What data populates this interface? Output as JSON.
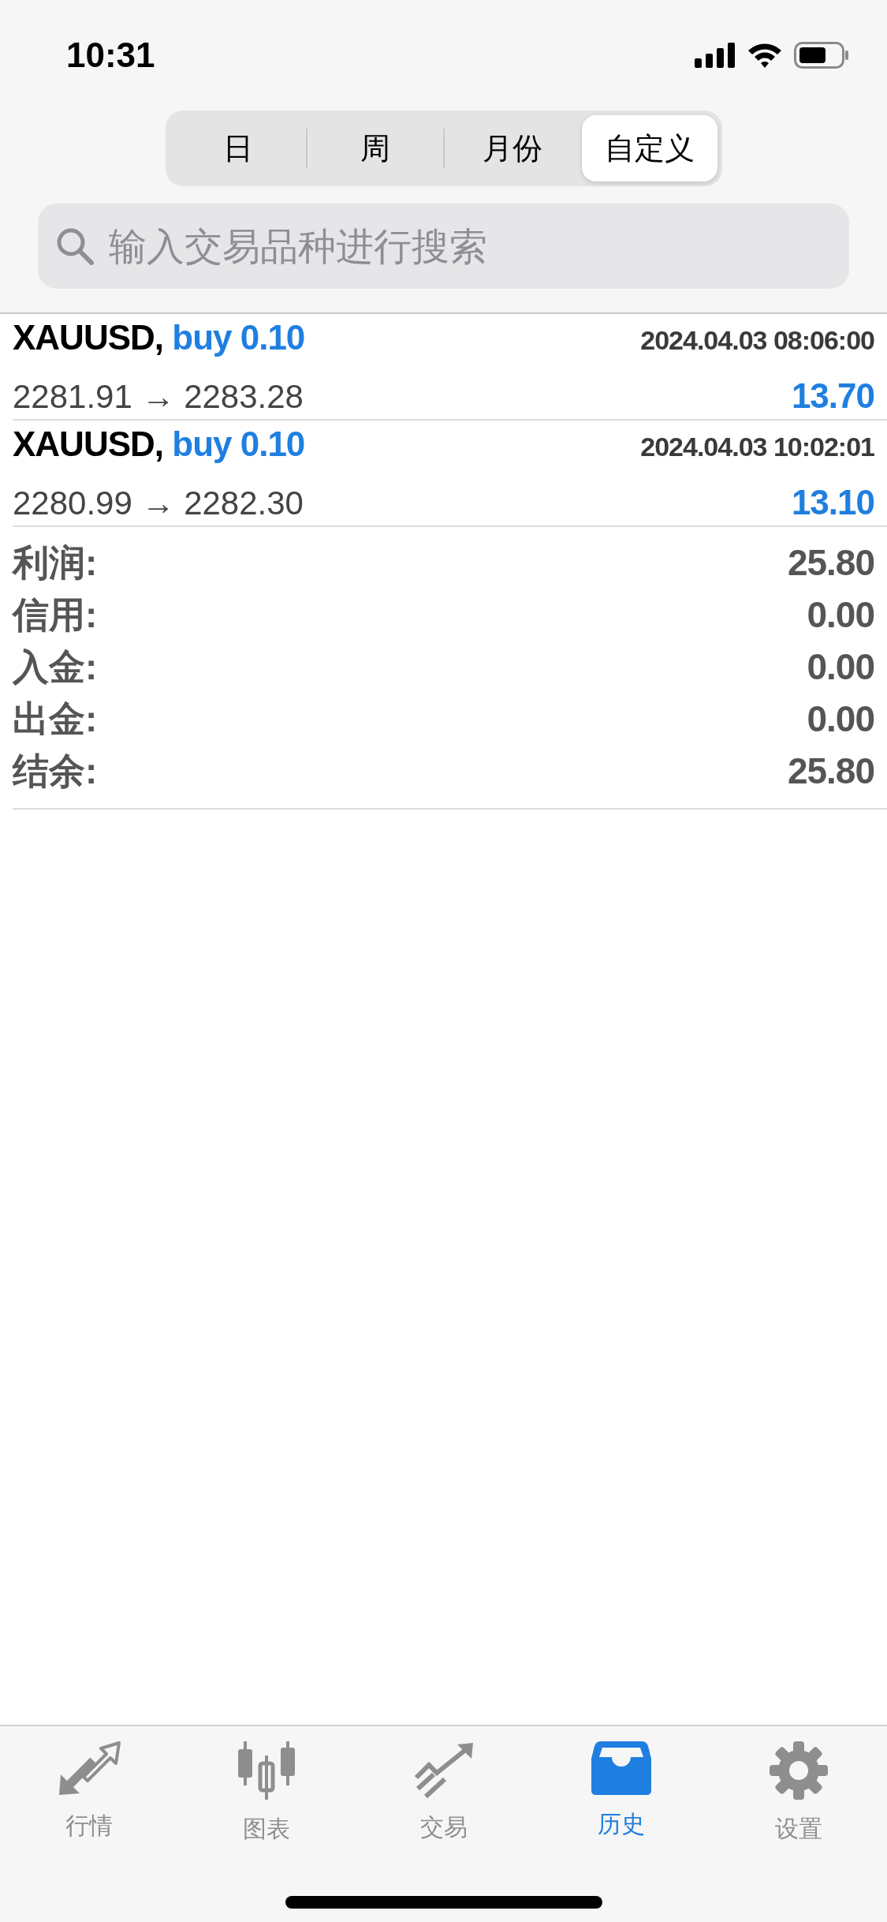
{
  "status_bar": {
    "time": "10:31"
  },
  "period_tabs": [
    {
      "label": "日",
      "selected": false
    },
    {
      "label": "周",
      "selected": false
    },
    {
      "label": "月份",
      "selected": false
    },
    {
      "label": "自定义",
      "selected": true
    }
  ],
  "search": {
    "placeholder": "输入交易品种进行搜索"
  },
  "trades": [
    {
      "symbol": "XAUUSD,",
      "side": "buy 0.10",
      "time": "2024.04.03 08:06:00",
      "prices": "2281.91 → 2283.28",
      "profit": "13.70"
    },
    {
      "symbol": "XAUUSD,",
      "side": "buy 0.10",
      "time": "2024.04.03 10:02:01",
      "prices": "2280.99 → 2282.30",
      "profit": "13.10"
    }
  ],
  "summary": [
    {
      "label": "利润:",
      "value": "25.80"
    },
    {
      "label": "信用:",
      "value": "0.00"
    },
    {
      "label": "入金:",
      "value": "0.00"
    },
    {
      "label": "出金:",
      "value": "0.00"
    },
    {
      "label": "结余:",
      "value": "25.80"
    }
  ],
  "tab_bar": [
    {
      "label": "行情",
      "selected": false
    },
    {
      "label": "图表",
      "selected": false
    },
    {
      "label": "交易",
      "selected": false
    },
    {
      "label": "历史",
      "selected": true
    },
    {
      "label": "设置",
      "selected": false
    }
  ]
}
